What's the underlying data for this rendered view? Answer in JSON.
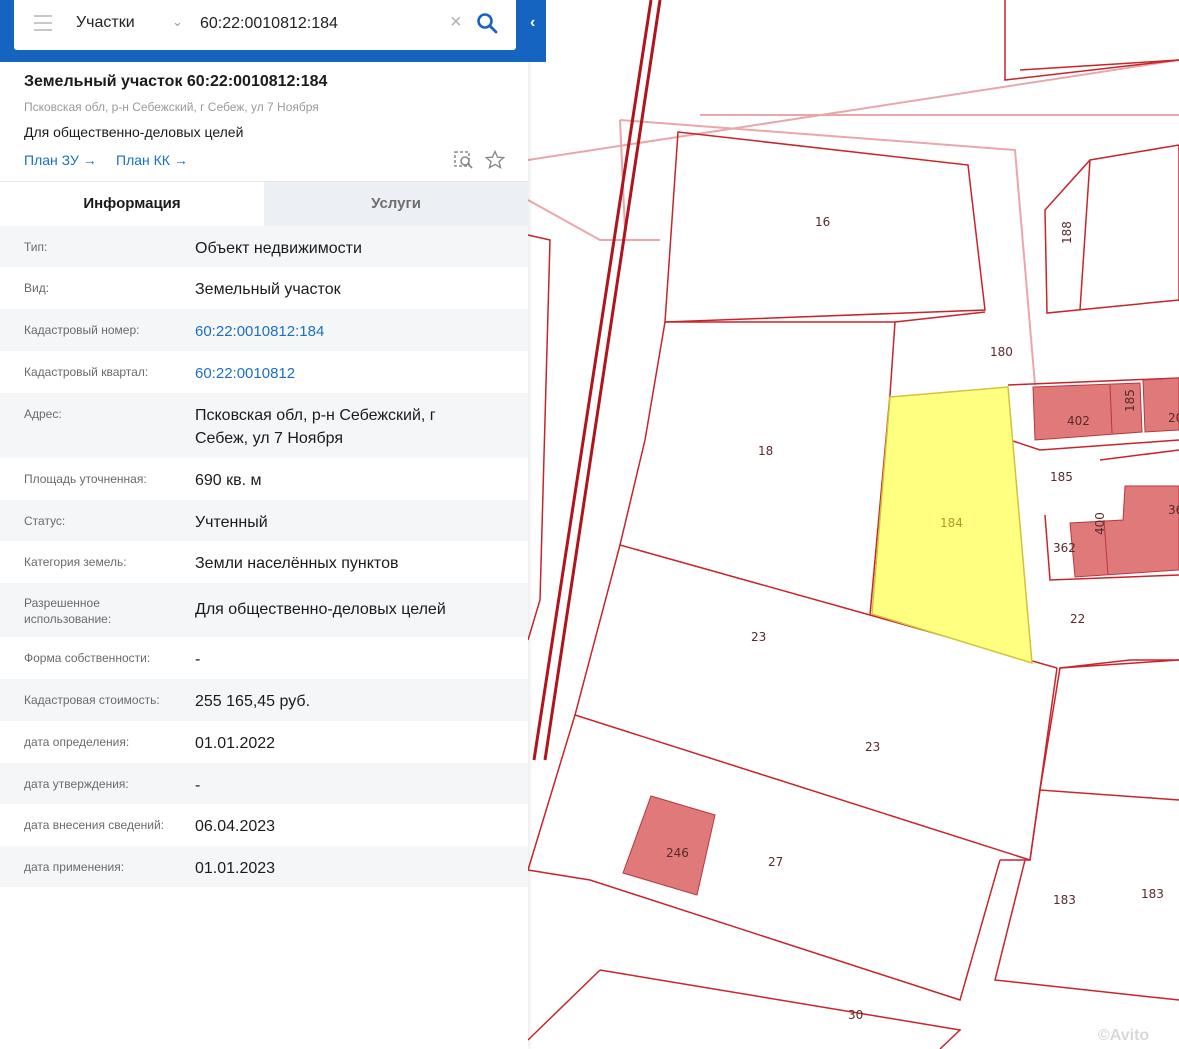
{
  "search": {
    "layer": "Участки",
    "query": "60:22:0010812:184"
  },
  "plot": {
    "title": "Земельный участок 60:22:0010812:184",
    "address": "Псковская обл, р-н Себежский, г Себеж, ул 7 Ноября",
    "usage": "Для общественно-деловых целей",
    "plan_zu": "План ЗУ →",
    "plan_kk": "План КК →"
  },
  "tabs": {
    "info": "Информация",
    "services": "Услуги"
  },
  "info": [
    {
      "key": "Тип:",
      "value": "Объект недвижимости"
    },
    {
      "key": "Вид:",
      "value": "Земельный участок"
    },
    {
      "key": "Кадастровый номер:",
      "value": "60:22:0010812:184"
    },
    {
      "key": "Кадастровый квартал:",
      "value": "60:22:0010812"
    },
    {
      "key": "Адрес:",
      "value": "Псковская обл, р-н Себежский, г Себеж, ул 7 Ноября"
    },
    {
      "key": "Площадь уточненная:",
      "value": "690 кв. м"
    },
    {
      "key": "Статус:",
      "value": "Учтенный"
    },
    {
      "key": "Категория земель:",
      "value": "Земли населённых пунктов"
    },
    {
      "key": "Разрешенное использование:",
      "value": "Для общественно-деловых целей"
    },
    {
      "key": "Форма собственности:",
      "value": "-"
    },
    {
      "key": "Кадастровая стоимость:",
      "value": "255 165,45 руб."
    },
    {
      "key": "дата определения:",
      "value": "01.01.2022"
    },
    {
      "key": "дата утверждения:",
      "value": "-"
    },
    {
      "key": "дата внесения сведений:",
      "value": "06.04.2023"
    },
    {
      "key": "дата применения:",
      "value": "01.01.2023"
    }
  ],
  "map": {
    "labels": [
      "16",
      "188",
      "180",
      "18",
      "184",
      "402",
      "185",
      "20",
      "185",
      "362",
      "400",
      "36",
      "22",
      "23",
      "23",
      "246",
      "27",
      "183",
      "183",
      "30"
    ],
    "watermark": "©Avito",
    "colors": {
      "selected": "#ffff80",
      "building": "#e07a7a",
      "boundary": "#c8242b"
    }
  }
}
